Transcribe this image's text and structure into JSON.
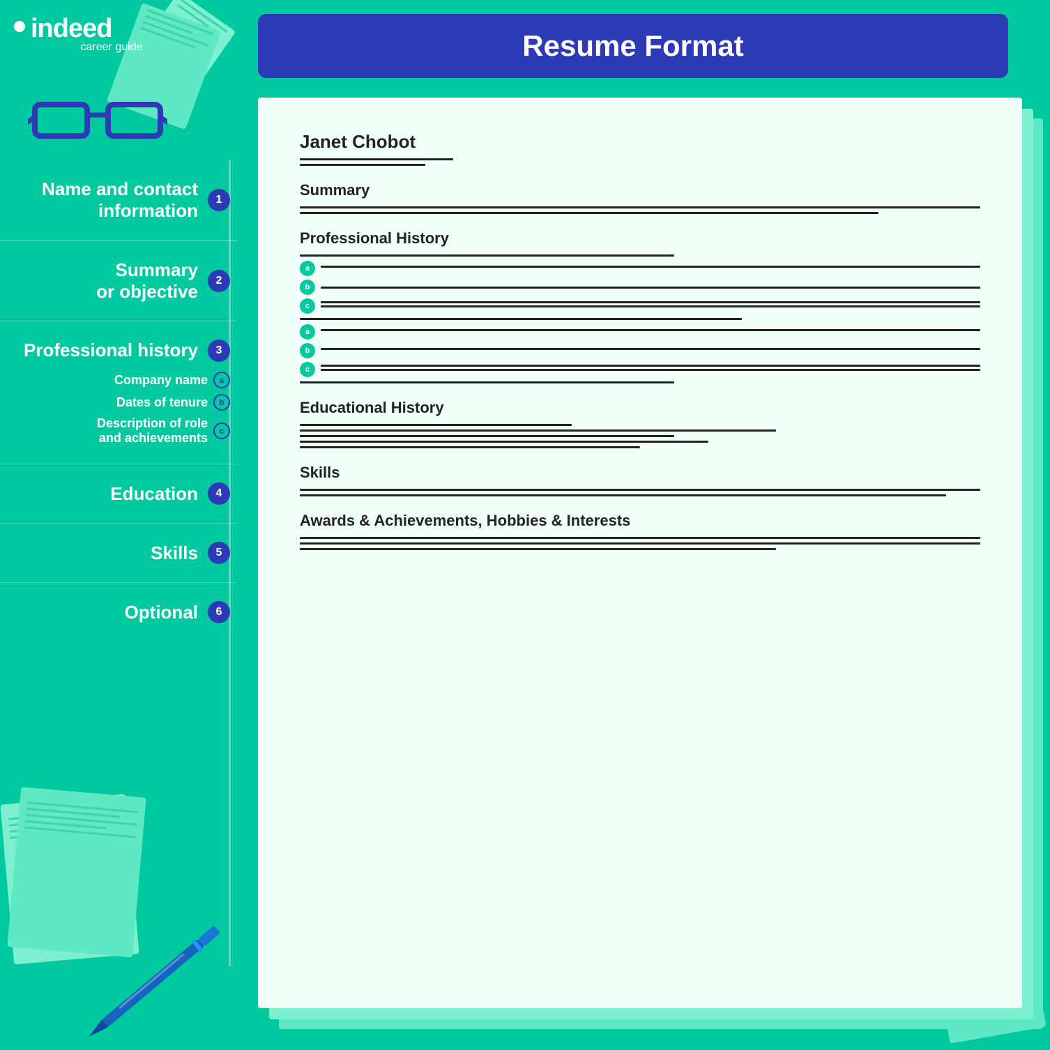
{
  "header": {
    "title": "Resume Format"
  },
  "logo": {
    "brand": "indeed",
    "tagline": "career guide"
  },
  "sidebar": {
    "items": [
      {
        "id": 1,
        "main_label": "Name and contact",
        "sub_label": "information",
        "number": "1",
        "sub_items": []
      },
      {
        "id": 2,
        "main_label": "Summary",
        "sub_label": "or objective",
        "number": "2",
        "sub_items": []
      },
      {
        "id": 3,
        "main_label": "Professional history",
        "sub_label": "",
        "number": "3",
        "sub_items": [
          {
            "letter": "a",
            "text": "Company name"
          },
          {
            "letter": "b",
            "text": "Dates of tenure"
          },
          {
            "letter": "c",
            "text": "Description of role and achievements"
          }
        ]
      },
      {
        "id": 4,
        "main_label": "Education",
        "sub_label": "",
        "number": "4",
        "sub_items": []
      },
      {
        "id": 5,
        "main_label": "Skills",
        "sub_label": "",
        "number": "5",
        "sub_items": []
      },
      {
        "id": 6,
        "main_label": "Optional",
        "sub_label": "",
        "number": "6",
        "sub_items": []
      }
    ]
  },
  "resume": {
    "name": "Janet Chobot",
    "sections": [
      {
        "title": "Summary"
      },
      {
        "title": "Professional History"
      },
      {
        "title": "Educational History"
      },
      {
        "title": "Skills"
      },
      {
        "title": "Awards & Achievements, Hobbies & Interests"
      }
    ]
  }
}
